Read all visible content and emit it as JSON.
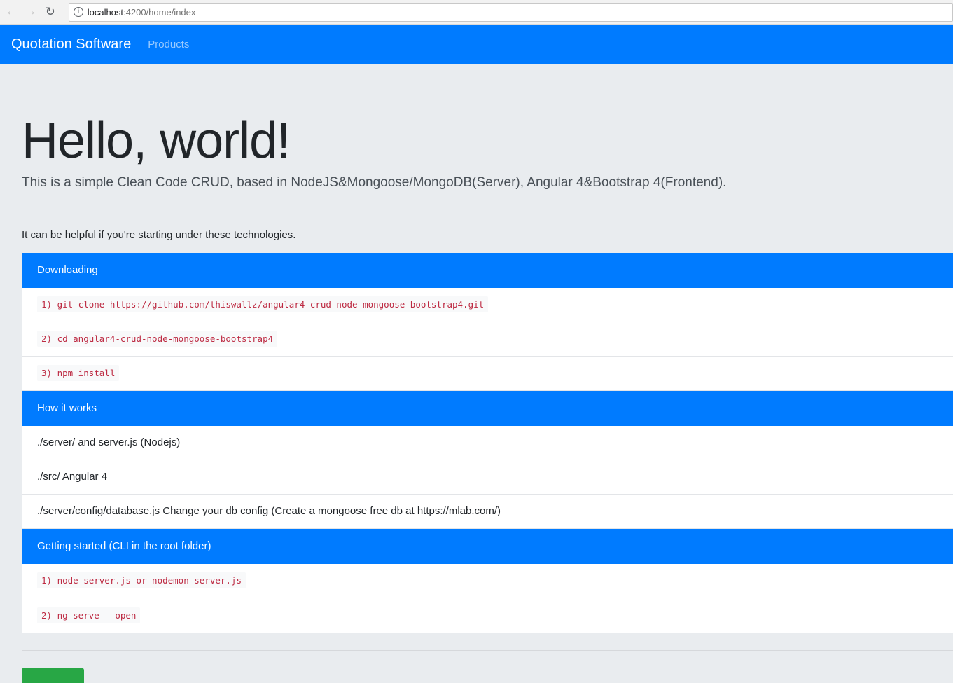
{
  "browser": {
    "url_host": "localhost",
    "url_path": ":4200/home/index"
  },
  "navbar": {
    "brand": "Quotation Software",
    "links": [
      "Products"
    ]
  },
  "jumbotron": {
    "title": "Hello, world!",
    "lead": "This is a simple Clean Code CRUD, based in NodeJS&Mongoose/MongoDB(Server), Angular 4&Bootstrap 4(Frontend).",
    "helpful": "It can be helpful if you're starting under these technologies."
  },
  "sections": [
    {
      "header": "Downloading",
      "items": [
        "1) git clone https://github.com/thiswallz/angular4-crud-node-mongoose-bootstrap4.git",
        "2) cd angular4-crud-node-mongoose-bootstrap4",
        "3) npm install"
      ]
    },
    {
      "header": "How it works",
      "items": [
        "./server/ and server.js (Nodejs)",
        "./src/ Angular 4",
        "./server/config/database.js Change your db config (Create a mongoose free db at https://mlab.com/)"
      ]
    },
    {
      "header": "Getting started (CLI in the root folder)",
      "items": [
        "1) node server.js or nodemon server.js",
        "2) ng serve --open"
      ]
    }
  ],
  "colors": {
    "primary": "#007bff",
    "background": "#e9ecef",
    "code_text": "#bd2a42",
    "success": "#28a745"
  }
}
